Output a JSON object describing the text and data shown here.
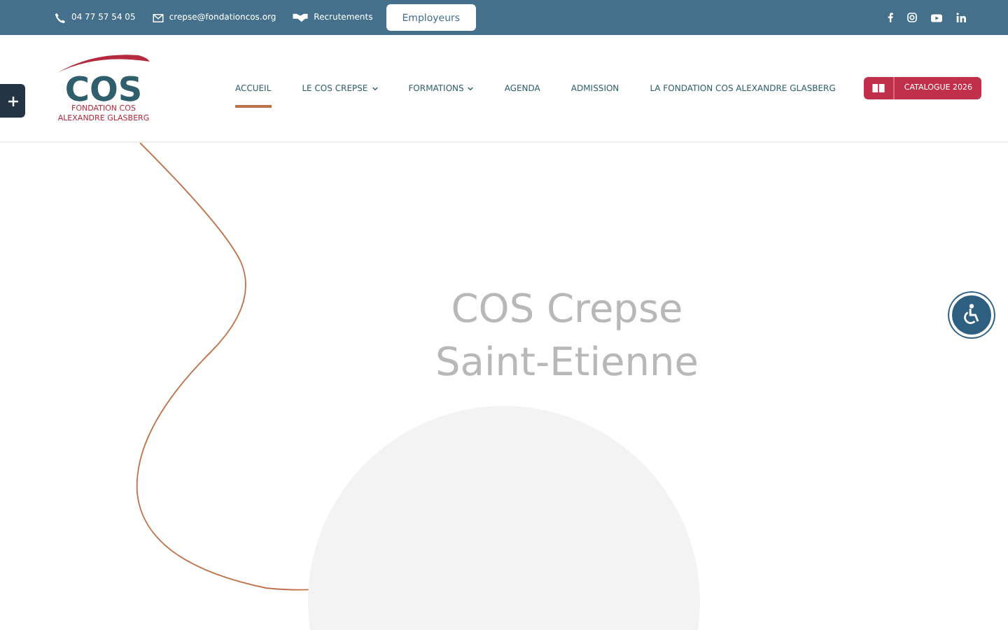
{
  "top_bar": {
    "phone": "04 77 57 54 05",
    "email": "crepse@fondationcos.org",
    "recruitment": "Recrutements",
    "employers_button": "Employeurs"
  },
  "logo": {
    "name": "COS",
    "line_1": "FONDATION COS",
    "line_2": "ALEXANDRE GLASBERG"
  },
  "nav": [
    {
      "label": "ACCUEIL",
      "selected": true,
      "dropdown": false
    },
    {
      "label": "LE COS CREPSE",
      "selected": false,
      "dropdown": true
    },
    {
      "label": "FORMATIONS",
      "selected": false,
      "dropdown": true
    },
    {
      "label": "AGENDA",
      "selected": false,
      "dropdown": false
    },
    {
      "label": "ADMISSION",
      "selected": false,
      "dropdown": false
    },
    {
      "label": "LA FONDATION COS ALEXANDRE GLASBERG",
      "selected": false,
      "dropdown": false
    }
  ],
  "catalogue_button": "CATALOGUE 2026",
  "hero": {
    "title_line_1": "COS Crepse",
    "title_line_2": "Saint-Etienne"
  }
}
